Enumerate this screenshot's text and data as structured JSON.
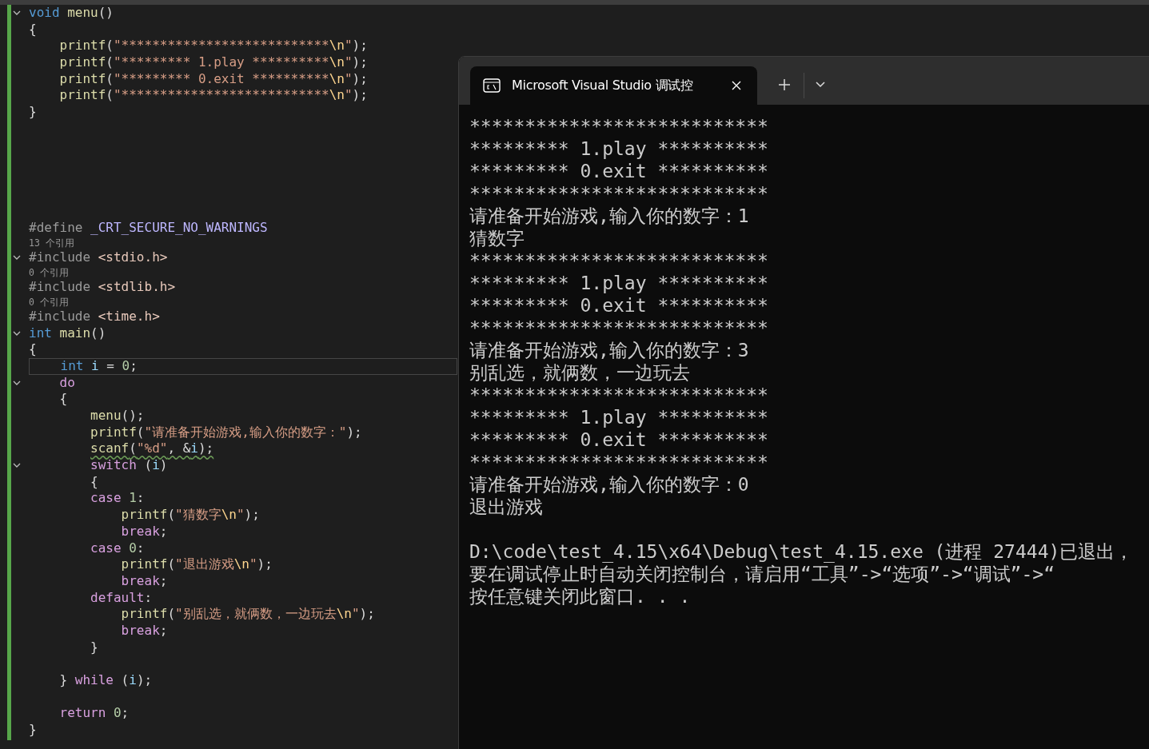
{
  "editor": {
    "lines": [
      {
        "kind": "code",
        "foldable": true,
        "current": false,
        "warning": false,
        "tokens": [
          {
            "kind": "keyword",
            "text": "void"
          },
          {
            "kind": "func",
            "text": " menu"
          },
          {
            "kind": "punct",
            "text": "()"
          }
        ]
      },
      {
        "kind": "code",
        "foldable": false,
        "current": false,
        "warning": false,
        "tokens": [
          {
            "kind": "punct",
            "text": "{"
          }
        ]
      },
      {
        "kind": "code",
        "foldable": false,
        "current": false,
        "warning": false,
        "tokens": [
          {
            "kind": "func",
            "text": "    printf"
          },
          {
            "kind": "punct",
            "text": "("
          },
          {
            "kind": "string",
            "text": "\"***************************"
          },
          {
            "kind": "escape",
            "text": "\\n"
          },
          {
            "kind": "string",
            "text": "\""
          },
          {
            "kind": "punct",
            "text": ");"
          }
        ]
      },
      {
        "kind": "code",
        "foldable": false,
        "current": false,
        "warning": false,
        "tokens": [
          {
            "kind": "func",
            "text": "    printf"
          },
          {
            "kind": "punct",
            "text": "("
          },
          {
            "kind": "string",
            "text": "\"********* 1.play **********"
          },
          {
            "kind": "escape",
            "text": "\\n"
          },
          {
            "kind": "string",
            "text": "\""
          },
          {
            "kind": "punct",
            "text": ");"
          }
        ]
      },
      {
        "kind": "code",
        "foldable": false,
        "current": false,
        "warning": false,
        "tokens": [
          {
            "kind": "func",
            "text": "    printf"
          },
          {
            "kind": "punct",
            "text": "("
          },
          {
            "kind": "string",
            "text": "\"********* 0.exit **********"
          },
          {
            "kind": "escape",
            "text": "\\n"
          },
          {
            "kind": "string",
            "text": "\""
          },
          {
            "kind": "punct",
            "text": ");"
          }
        ]
      },
      {
        "kind": "code",
        "foldable": false,
        "current": false,
        "warning": false,
        "tokens": [
          {
            "kind": "func",
            "text": "    printf"
          },
          {
            "kind": "punct",
            "text": "("
          },
          {
            "kind": "string",
            "text": "\"***************************"
          },
          {
            "kind": "escape",
            "text": "\\n"
          },
          {
            "kind": "string",
            "text": "\""
          },
          {
            "kind": "punct",
            "text": ");"
          }
        ]
      },
      {
        "kind": "code",
        "foldable": false,
        "current": false,
        "warning": false,
        "tokens": [
          {
            "kind": "punct",
            "text": "}"
          }
        ]
      },
      {
        "kind": "blank"
      },
      {
        "kind": "blank"
      },
      {
        "kind": "blank"
      },
      {
        "kind": "blank"
      },
      {
        "kind": "blank"
      },
      {
        "kind": "blank"
      },
      {
        "kind": "code",
        "foldable": false,
        "current": false,
        "warning": false,
        "tokens": [
          {
            "kind": "preproc",
            "text": "#define"
          },
          {
            "kind": "macro",
            "text": " _CRT_SECURE_NO_WARNINGS"
          }
        ]
      },
      {
        "kind": "lens",
        "text": "13 个引用"
      },
      {
        "kind": "code",
        "foldable": true,
        "current": false,
        "warning": false,
        "tokens": [
          {
            "kind": "preproc",
            "text": "#include"
          },
          {
            "kind": "include",
            "text": " <stdio.h>"
          }
        ]
      },
      {
        "kind": "lens",
        "text": "0 个引用"
      },
      {
        "kind": "code",
        "foldable": false,
        "current": false,
        "warning": false,
        "tokens": [
          {
            "kind": "preproc",
            "text": "#include"
          },
          {
            "kind": "include",
            "text": " <stdlib.h>"
          }
        ]
      },
      {
        "kind": "lens",
        "text": "0 个引用"
      },
      {
        "kind": "code",
        "foldable": false,
        "current": false,
        "warning": false,
        "tokens": [
          {
            "kind": "preproc",
            "text": "#include"
          },
          {
            "kind": "include",
            "text": " <time.h>"
          }
        ]
      },
      {
        "kind": "code",
        "foldable": true,
        "current": false,
        "warning": false,
        "tokens": [
          {
            "kind": "keyword",
            "text": "int"
          },
          {
            "kind": "func",
            "text": " main"
          },
          {
            "kind": "punct",
            "text": "()"
          }
        ]
      },
      {
        "kind": "code",
        "foldable": false,
        "current": false,
        "warning": false,
        "tokens": [
          {
            "kind": "punct",
            "text": "{"
          }
        ]
      },
      {
        "kind": "code",
        "foldable": false,
        "current": true,
        "warning": false,
        "tokens": [
          {
            "kind": "keyword",
            "text": "    int"
          },
          {
            "kind": "var",
            "text": " i"
          },
          {
            "kind": "punct",
            "text": " = "
          },
          {
            "kind": "number",
            "text": "0"
          },
          {
            "kind": "punct",
            "text": ";"
          }
        ]
      },
      {
        "kind": "code",
        "foldable": true,
        "current": false,
        "warning": false,
        "tokens": [
          {
            "kind": "control",
            "text": "    do"
          }
        ]
      },
      {
        "kind": "code",
        "foldable": false,
        "current": false,
        "warning": false,
        "tokens": [
          {
            "kind": "punct",
            "text": "    {"
          }
        ]
      },
      {
        "kind": "code",
        "foldable": false,
        "current": false,
        "warning": false,
        "tokens": [
          {
            "kind": "func",
            "text": "        menu"
          },
          {
            "kind": "punct",
            "text": "();"
          }
        ]
      },
      {
        "kind": "code",
        "foldable": false,
        "current": false,
        "warning": false,
        "tokens": [
          {
            "kind": "func",
            "text": "        printf"
          },
          {
            "kind": "punct",
            "text": "("
          },
          {
            "kind": "string",
            "text": "\"请准备开始游戏,输入你的数字：\""
          },
          {
            "kind": "punct",
            "text": ");"
          }
        ]
      },
      {
        "kind": "code",
        "foldable": false,
        "current": false,
        "warning": true,
        "tokens": [
          {
            "kind": "func",
            "text": "        scanf"
          },
          {
            "kind": "punct",
            "text": "("
          },
          {
            "kind": "string",
            "text": "\"%d\""
          },
          {
            "kind": "punct",
            "text": ", &"
          },
          {
            "kind": "var",
            "text": "i"
          },
          {
            "kind": "punct",
            "text": ");"
          }
        ]
      },
      {
        "kind": "code",
        "foldable": true,
        "current": false,
        "warning": false,
        "tokens": [
          {
            "kind": "control",
            "text": "        switch"
          },
          {
            "kind": "punct",
            "text": " ("
          },
          {
            "kind": "var",
            "text": "i"
          },
          {
            "kind": "punct",
            "text": ")"
          }
        ]
      },
      {
        "kind": "code",
        "foldable": false,
        "current": false,
        "warning": false,
        "tokens": [
          {
            "kind": "punct",
            "text": "        {"
          }
        ]
      },
      {
        "kind": "code",
        "foldable": false,
        "current": false,
        "warning": false,
        "tokens": [
          {
            "kind": "control",
            "text": "        case"
          },
          {
            "kind": "number",
            "text": " 1"
          },
          {
            "kind": "punct",
            "text": ":"
          }
        ]
      },
      {
        "kind": "code",
        "foldable": false,
        "current": false,
        "warning": false,
        "tokens": [
          {
            "kind": "func",
            "text": "            printf"
          },
          {
            "kind": "punct",
            "text": "("
          },
          {
            "kind": "string",
            "text": "\"猜数字"
          },
          {
            "kind": "escape",
            "text": "\\n"
          },
          {
            "kind": "string",
            "text": "\""
          },
          {
            "kind": "punct",
            "text": ");"
          }
        ]
      },
      {
        "kind": "code",
        "foldable": false,
        "current": false,
        "warning": false,
        "tokens": [
          {
            "kind": "control",
            "text": "            break"
          },
          {
            "kind": "punct",
            "text": ";"
          }
        ]
      },
      {
        "kind": "code",
        "foldable": false,
        "current": false,
        "warning": false,
        "tokens": [
          {
            "kind": "control",
            "text": "        case"
          },
          {
            "kind": "number",
            "text": " 0"
          },
          {
            "kind": "punct",
            "text": ":"
          }
        ]
      },
      {
        "kind": "code",
        "foldable": false,
        "current": false,
        "warning": false,
        "tokens": [
          {
            "kind": "func",
            "text": "            printf"
          },
          {
            "kind": "punct",
            "text": "("
          },
          {
            "kind": "string",
            "text": "\"退出游戏"
          },
          {
            "kind": "escape",
            "text": "\\n"
          },
          {
            "kind": "string",
            "text": "\""
          },
          {
            "kind": "punct",
            "text": ");"
          }
        ]
      },
      {
        "kind": "code",
        "foldable": false,
        "current": false,
        "warning": false,
        "tokens": [
          {
            "kind": "control",
            "text": "            break"
          },
          {
            "kind": "punct",
            "text": ";"
          }
        ]
      },
      {
        "kind": "code",
        "foldable": false,
        "current": false,
        "warning": false,
        "tokens": [
          {
            "kind": "control",
            "text": "        default"
          },
          {
            "kind": "punct",
            "text": ":"
          }
        ]
      },
      {
        "kind": "code",
        "foldable": false,
        "current": false,
        "warning": false,
        "tokens": [
          {
            "kind": "func",
            "text": "            printf"
          },
          {
            "kind": "punct",
            "text": "("
          },
          {
            "kind": "string",
            "text": "\"别乱选，就俩数，一边玩去"
          },
          {
            "kind": "escape",
            "text": "\\n"
          },
          {
            "kind": "string",
            "text": "\""
          },
          {
            "kind": "punct",
            "text": ");"
          }
        ]
      },
      {
        "kind": "code",
        "foldable": false,
        "current": false,
        "warning": false,
        "tokens": [
          {
            "kind": "control",
            "text": "            break"
          },
          {
            "kind": "punct",
            "text": ";"
          }
        ]
      },
      {
        "kind": "code",
        "foldable": false,
        "current": false,
        "warning": false,
        "tokens": [
          {
            "kind": "punct",
            "text": "        }"
          }
        ]
      },
      {
        "kind": "blank"
      },
      {
        "kind": "code",
        "foldable": false,
        "current": false,
        "warning": false,
        "tokens": [
          {
            "kind": "punct",
            "text": "    } "
          },
          {
            "kind": "control",
            "text": "while"
          },
          {
            "kind": "punct",
            "text": " ("
          },
          {
            "kind": "var",
            "text": "i"
          },
          {
            "kind": "punct",
            "text": ");"
          }
        ]
      },
      {
        "kind": "blank"
      },
      {
        "kind": "code",
        "foldable": false,
        "current": false,
        "warning": false,
        "tokens": [
          {
            "kind": "control",
            "text": "    return"
          },
          {
            "kind": "number",
            "text": " 0"
          },
          {
            "kind": "punct",
            "text": ";"
          }
        ]
      },
      {
        "kind": "code",
        "foldable": false,
        "current": false,
        "warning": false,
        "tokens": [
          {
            "kind": "punct",
            "text": "}"
          }
        ]
      }
    ]
  },
  "terminal": {
    "tab": {
      "title": "Microsoft Visual Studio 调试控",
      "selected": true
    },
    "output": [
      "***************************",
      "********* 1.play **********",
      "********* 0.exit **********",
      "***************************",
      "请准备开始游戏,输入你的数字：1",
      "猜数字",
      "***************************",
      "********* 1.play **********",
      "********* 0.exit **********",
      "***************************",
      "请准备开始游戏,输入你的数字：3",
      "别乱选，就俩数，一边玩去",
      "***************************",
      "********* 1.play **********",
      "********* 0.exit **********",
      "***************************",
      "请准备开始游戏,输入你的数字：0",
      "退出游戏"
    ],
    "exit_message": [
      "D:\\code\\test_4.15\\x64\\Debug\\test_4.15.exe (进程 27444)已退出，",
      "要在调试停止时自动关闭控制台，请启用“工具”->“选项”->“调试”->“",
      "按任意键关闭此窗口. . ."
    ]
  }
}
